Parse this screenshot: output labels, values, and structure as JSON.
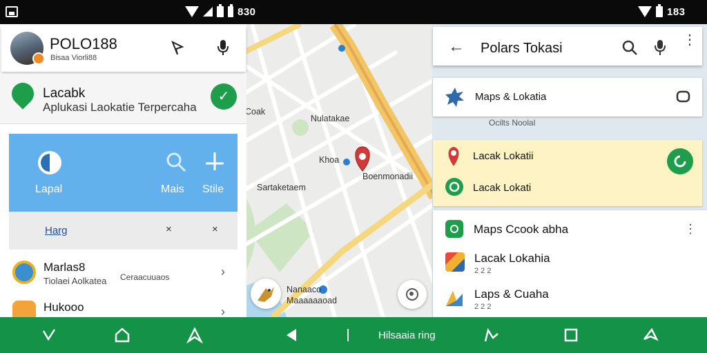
{
  "status_bar": {
    "time_left": "830",
    "time_right": "183"
  },
  "profile": {
    "name": "POLO188",
    "subtitle": "Bisaa Viorli88"
  },
  "app_card": {
    "title": "Lacabk",
    "subtitle": "Aplukasi Laokatie Terpercaha"
  },
  "blue_card": {
    "items": [
      {
        "label": "Lapal",
        "icon": "play-icon"
      },
      {
        "label": "Mais",
        "icon": "search-icon"
      },
      {
        "label": "Stile",
        "icon": "plus-icon"
      }
    ]
  },
  "tabs": {
    "link": "Harg",
    "x1": "×",
    "x2": "×"
  },
  "left_list": [
    {
      "title": "Marlas8",
      "subtitle": "Tiolaei Aolkatea",
      "extra": "Ceraacuuaos"
    },
    {
      "title": "Hukooo",
      "subtitle": ""
    }
  ],
  "map": {
    "labels": {
      "a": "Coak",
      "b": "Nulatakae",
      "c": "Khoa",
      "d": "Boenmonadii",
      "e": "Sartaketaem",
      "f": "Nanaaco",
      "g": "Maaaaaaoad"
    }
  },
  "right": {
    "search_title": "Polars Tokasi",
    "maps_card": "Maps & Lokatia",
    "map_label": "Ocilts Noolal",
    "yellow_items": [
      "Lacak Lokatii",
      "Lacak Lokati"
    ],
    "list_header": "Maps Ccook abha",
    "list_items": [
      {
        "title": "Lacak Lokahia",
        "sub": "2 2 2"
      },
      {
        "title": "Laps & Cuaha",
        "sub": "2 2 2"
      }
    ]
  },
  "nav": {
    "label": "Hilsaaia ring"
  },
  "colors": {
    "green": "#149247",
    "blue": "#62b0ec",
    "yellow": "#fdf3c4"
  }
}
